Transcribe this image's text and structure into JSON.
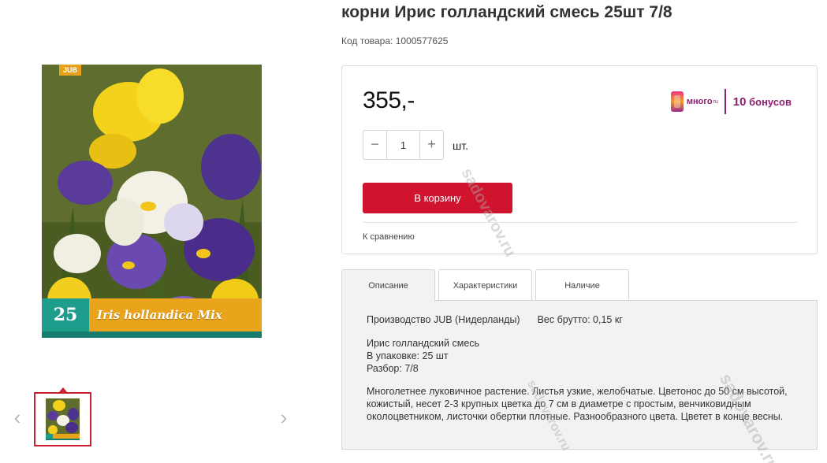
{
  "product": {
    "title": "корни Ирис голландский смесь 25шт 7/8",
    "code_label": "Код товара:",
    "code_value": "1000577625",
    "image_alt": "Iris hollandica Mix",
    "pack": {
      "brand": "JUB",
      "count": "25",
      "name": "Iris hollandica Mix"
    }
  },
  "gallery": {
    "prev_icon": "‹",
    "next_icon": "›"
  },
  "buy": {
    "price": "355,-",
    "bonus": {
      "logo_text": "много",
      "logo_sup": "ru",
      "number": "10",
      "label": "бонусов"
    },
    "quantity": {
      "minus": "−",
      "value": "1",
      "plus": "+",
      "unit": "шт."
    },
    "cart_button": "В корзину",
    "compare_link": "К сравнению"
  },
  "tabs": [
    {
      "label": "Описание",
      "active": true
    },
    {
      "label": "Характеристики",
      "active": false
    },
    {
      "label": "Наличие",
      "active": false
    }
  ],
  "details": {
    "manufacturer": "Производство JUB (Нидерланды)",
    "weight": "Вес брутто: 0,15 кг",
    "name_line": "Ирис голландский смесь",
    "pack_line": "В упаковке: 25 шт",
    "grade_line": "Разбор: 7/8",
    "description": "Многолетнее луковичное растение. Листья узкие, желобчатые. Цветонос до 50 см высотой, кожистый, несет 2-3 крупных цветка до 7 см в диаметре с простым, венчиковидным околоцветником, листочки обертки плотные. Разнообразного цвета. Цветет в конце весны."
  },
  "watermark": "sadovarov.ru",
  "colors": {
    "accent_red": "#d1142e",
    "bonus_purple": "#8a1f6e",
    "pack_teal": "#1e9c8c",
    "pack_yellow": "#e9a41c"
  }
}
